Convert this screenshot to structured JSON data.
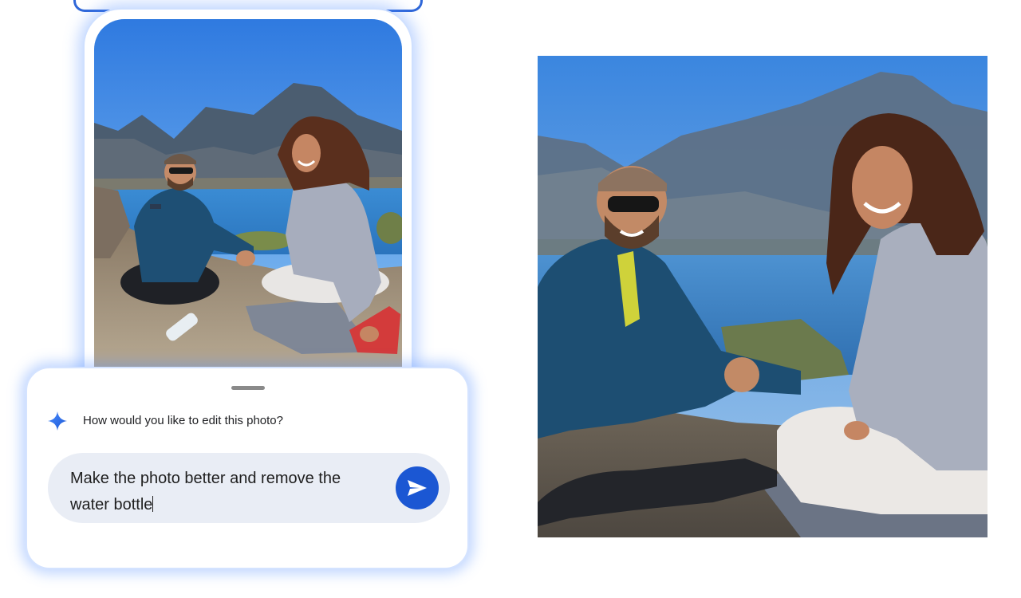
{
  "prompt_panel": {
    "question": "How would you like to edit this photo?",
    "input_value": "Make the photo better and remove the water bottle",
    "send_icon": "send-arrow-icon",
    "sparkle_icon": "gemini-sparkle-icon"
  },
  "colors": {
    "accent": "#1b57d3",
    "glow": "#5a8cff",
    "input_bg": "#e9edf5"
  }
}
